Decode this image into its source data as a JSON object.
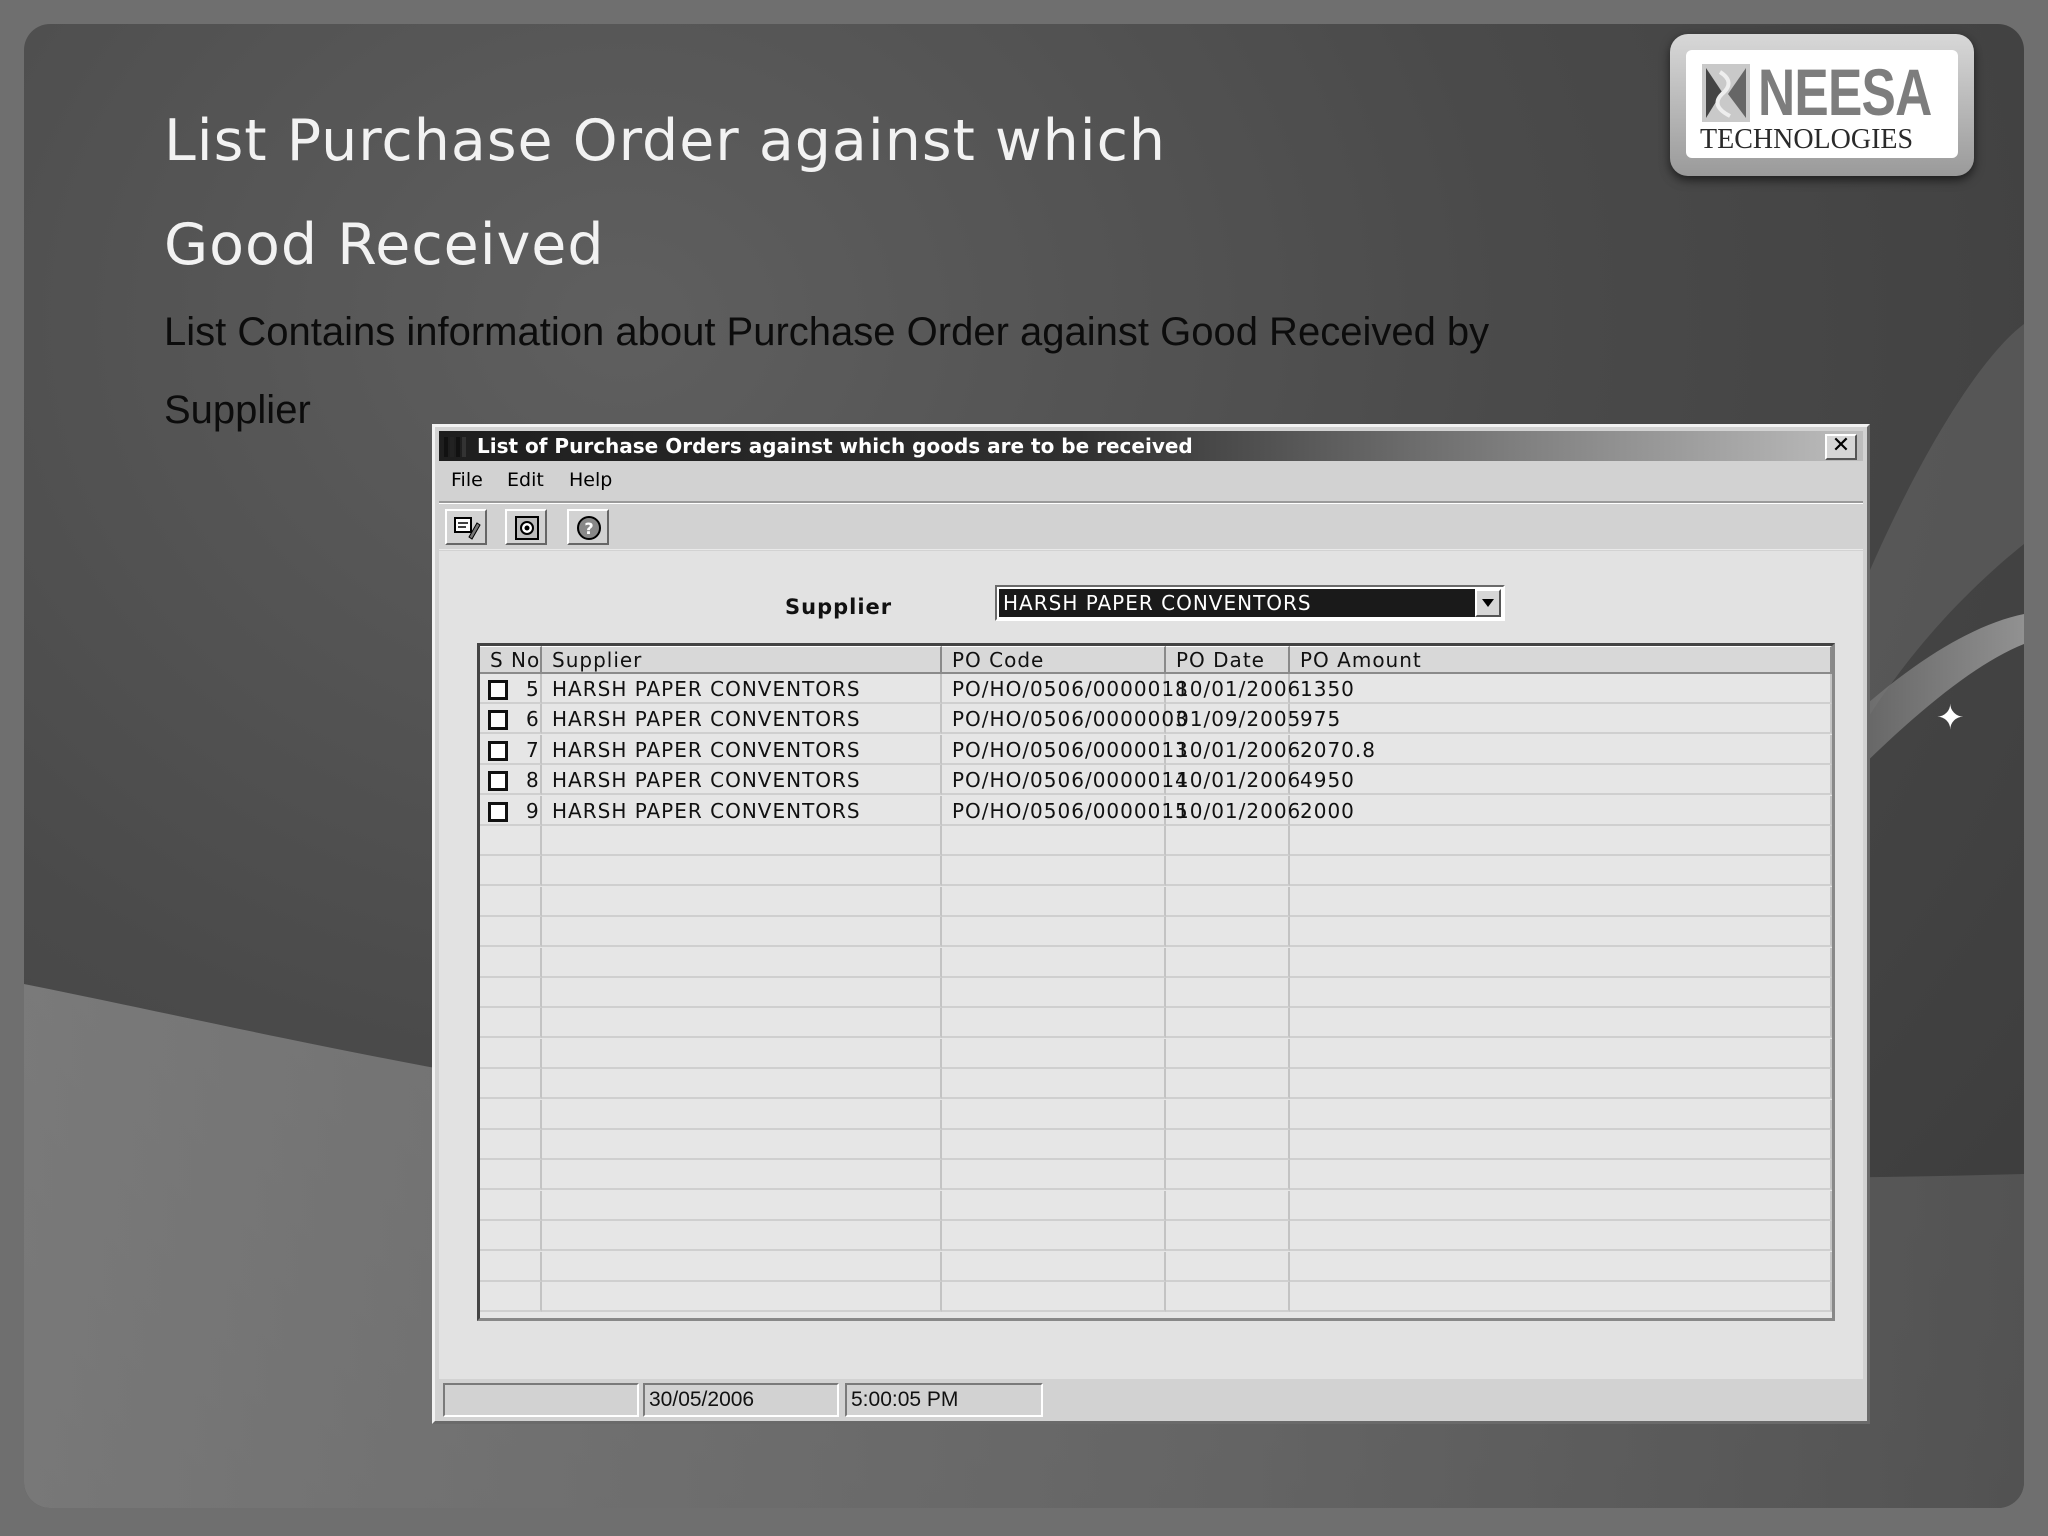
{
  "slide": {
    "title_line1": "List Purchase Order against which",
    "title_line2": "Good Received",
    "subtitle_line1": "List Contains information about Purchase Order against  Good Received by",
    "subtitle_line2": "Supplier"
  },
  "logo": {
    "brand": "NEESA",
    "tagline": "TECHNOLOGIES"
  },
  "window": {
    "title": "List of Purchase Orders against which goods are to be received",
    "close_label": "✕",
    "menu": [
      "File",
      "Edit",
      "Help"
    ],
    "toolbar_icons": [
      "edit-icon",
      "view-icon",
      "help-icon"
    ]
  },
  "filter": {
    "supplier_label": "Supplier",
    "supplier_value": "HARSH PAPER CONVENTORS"
  },
  "grid": {
    "columns": [
      "S No",
      "Supplier",
      "PO Code",
      "PO Date",
      "PO Amount"
    ],
    "rows": [
      {
        "sno": "5",
        "supplier": "HARSH PAPER CONVENTORS",
        "po_code": "PO/HO/0506/0000018",
        "po_date": "10/01/2006",
        "po_amount": "1350"
      },
      {
        "sno": "6",
        "supplier": "HARSH PAPER CONVENTORS",
        "po_code": "PO/HO/0506/0000003",
        "po_date": "01/09/2005",
        "po_amount": "975"
      },
      {
        "sno": "7",
        "supplier": "HARSH PAPER CONVENTORS",
        "po_code": "PO/HO/0506/0000013",
        "po_date": "10/01/2006",
        "po_amount": "2070.8"
      },
      {
        "sno": "8",
        "supplier": "HARSH PAPER CONVENTORS",
        "po_code": "PO/HO/0506/0000014",
        "po_date": "10/01/2006",
        "po_amount": "4950"
      },
      {
        "sno": "9",
        "supplier": "HARSH PAPER CONVENTORS",
        "po_code": "PO/HO/0506/0000015",
        "po_date": "10/01/2006",
        "po_amount": "2000"
      }
    ]
  },
  "status": {
    "panel1": "",
    "date": "30/05/2006",
    "time": "5:00:05 PM"
  }
}
